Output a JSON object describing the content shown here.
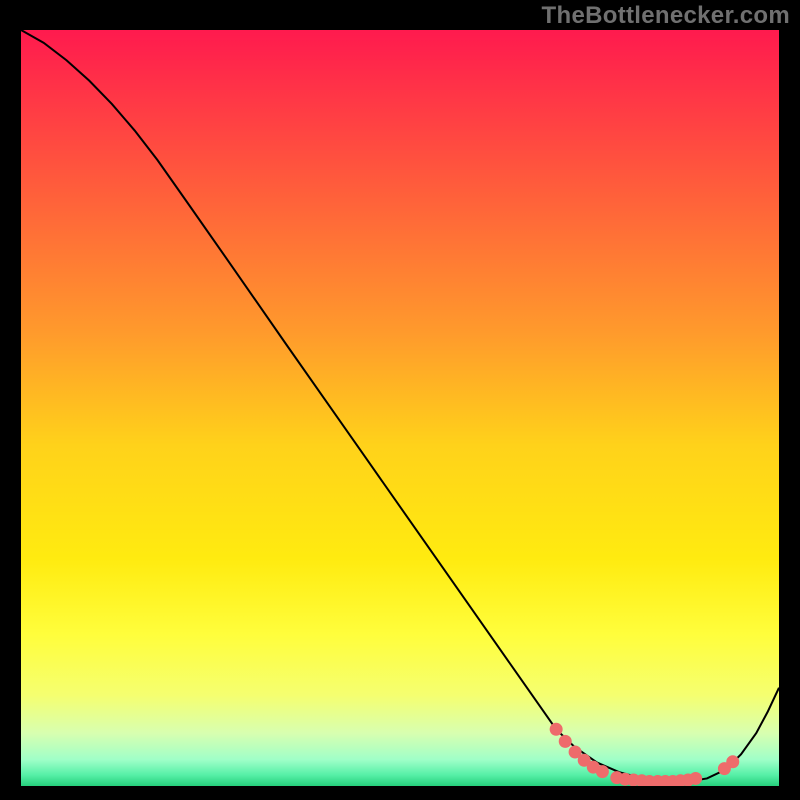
{
  "watermark": "TheBottlenecker.com",
  "chart_data": {
    "type": "line",
    "title": "",
    "xlabel": "",
    "ylabel": "",
    "xlim": [
      0,
      100
    ],
    "ylim": [
      0,
      100
    ],
    "background_gradient": {
      "stops": [
        {
          "offset": 0.0,
          "color": "#ff1a4e"
        },
        {
          "offset": 0.2,
          "color": "#ff5a3c"
        },
        {
          "offset": 0.4,
          "color": "#ff9a2c"
        },
        {
          "offset": 0.55,
          "color": "#ffd21a"
        },
        {
          "offset": 0.7,
          "color": "#ffeb10"
        },
        {
          "offset": 0.8,
          "color": "#fffe3c"
        },
        {
          "offset": 0.88,
          "color": "#f5ff70"
        },
        {
          "offset": 0.93,
          "color": "#d8ffb0"
        },
        {
          "offset": 0.965,
          "color": "#a0ffc8"
        },
        {
          "offset": 0.985,
          "color": "#58f0a8"
        },
        {
          "offset": 1.0,
          "color": "#26d07c"
        }
      ]
    },
    "series": [
      {
        "name": "bottleneck-curve",
        "stroke": "#000000",
        "stroke_width": 2,
        "x": [
          0.0,
          3.0,
          6.0,
          9.0,
          12.0,
          15.0,
          18.0,
          22.0,
          28.0,
          35.0,
          45.0,
          55.0,
          65.0,
          70.6,
          73.0,
          76.0,
          79.0,
          82.0,
          85.0,
          88.0,
          90.5,
          93.0,
          95.0,
          97.0,
          98.5,
          100.0
        ],
        "y": [
          100.0,
          98.3,
          96.0,
          93.3,
          90.2,
          86.7,
          82.8,
          77.1,
          68.5,
          58.4,
          44.1,
          29.8,
          15.5,
          7.5,
          5.2,
          3.1,
          1.8,
          1.0,
          0.6,
          0.6,
          1.0,
          2.2,
          4.2,
          7.0,
          9.8,
          13.0
        ]
      }
    ],
    "markers": {
      "name": "highlight-dots",
      "color": "#ee6b6b",
      "radius": 6.5,
      "points": [
        {
          "x": 70.6,
          "y": 7.5
        },
        {
          "x": 71.8,
          "y": 5.9
        },
        {
          "x": 73.1,
          "y": 4.5
        },
        {
          "x": 74.3,
          "y": 3.4
        },
        {
          "x": 75.5,
          "y": 2.5
        },
        {
          "x": 76.7,
          "y": 1.9
        },
        {
          "x": 78.6,
          "y": 1.1
        },
        {
          "x": 79.7,
          "y": 0.9
        },
        {
          "x": 80.8,
          "y": 0.8
        },
        {
          "x": 81.9,
          "y": 0.7
        },
        {
          "x": 82.9,
          "y": 0.6
        },
        {
          "x": 84.0,
          "y": 0.6
        },
        {
          "x": 85.0,
          "y": 0.6
        },
        {
          "x": 86.0,
          "y": 0.6
        },
        {
          "x": 87.0,
          "y": 0.7
        },
        {
          "x": 88.0,
          "y": 0.8
        },
        {
          "x": 89.0,
          "y": 1.0
        },
        {
          "x": 92.8,
          "y": 2.3
        },
        {
          "x": 93.9,
          "y": 3.2
        }
      ]
    }
  }
}
